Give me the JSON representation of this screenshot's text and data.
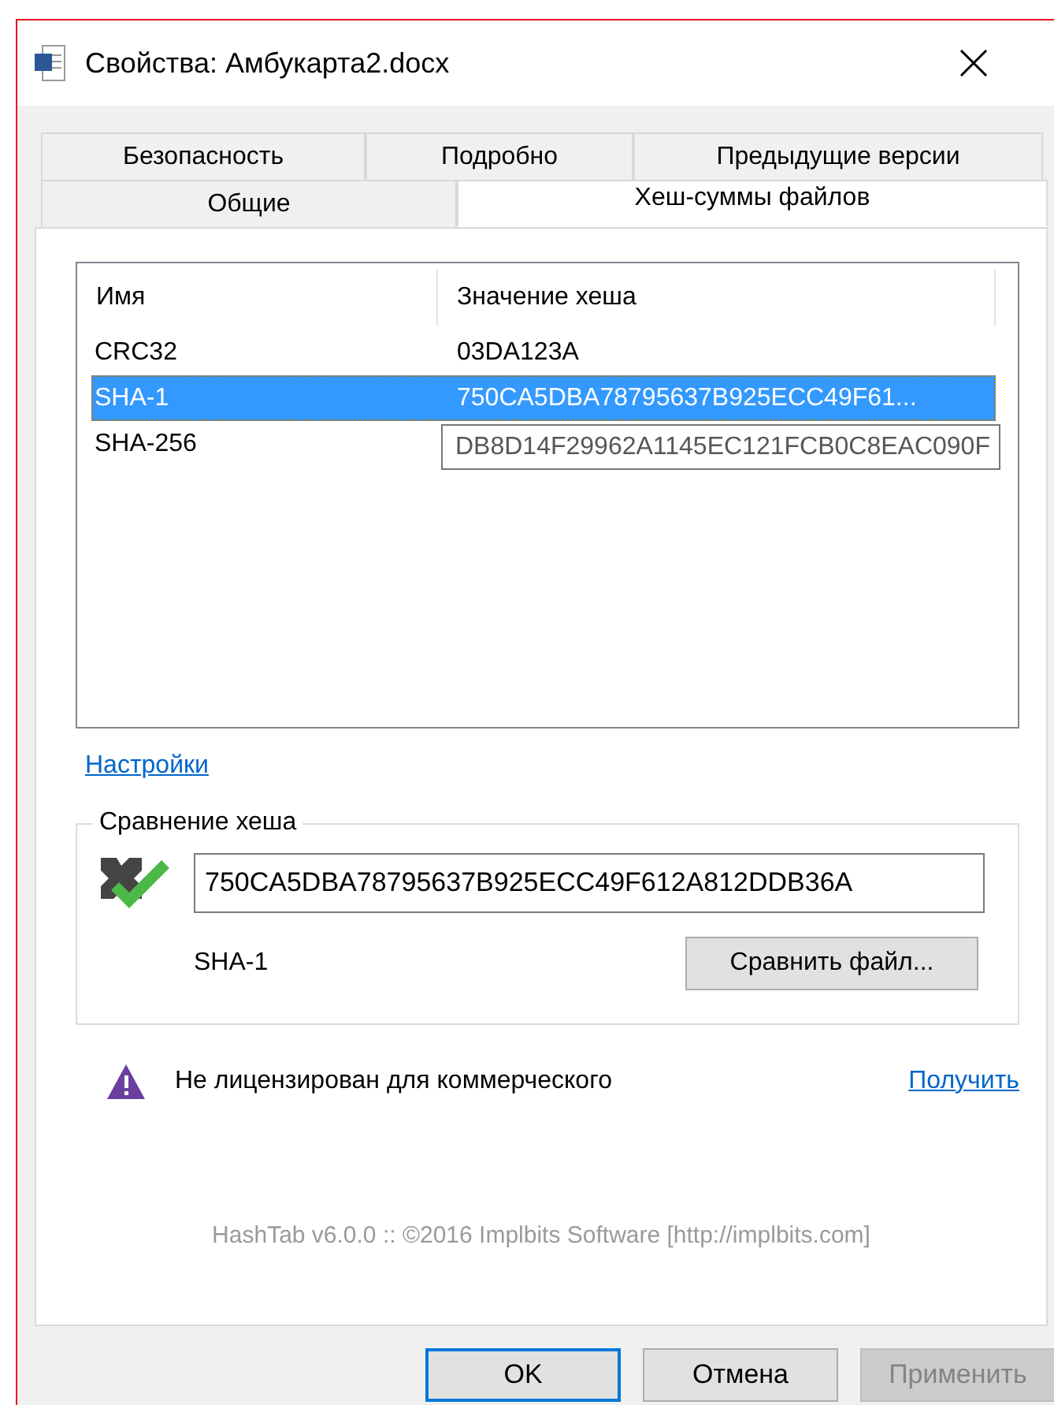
{
  "window": {
    "title": "Свойства: Амбукарта2.docx"
  },
  "tab_rows": [
    {
      "tabs": [
        {
          "label": "Безопасность",
          "selected": false
        },
        {
          "label": "Подробно",
          "selected": false
        },
        {
          "label": "Предыдущие версии",
          "selected": false
        }
      ]
    },
    {
      "tabs": [
        {
          "label": "Общие",
          "selected": false
        },
        {
          "label": "Хеш-суммы файлов",
          "selected": true
        }
      ]
    }
  ],
  "hash_list": {
    "columns": [
      "Имя",
      "Значение хеша"
    ],
    "rows": [
      {
        "name": "CRC32",
        "value": "03DA123A",
        "selected": false
      },
      {
        "name": "SHA-1",
        "value": "750CA5DBA78795637B925ECC49F61...",
        "selected": true
      },
      {
        "name": "SHA-256",
        "selected": false
      }
    ],
    "tooltip": "DB8D14F29962A1145EC121FCB0C8EAC090F"
  },
  "settings_link": "Настройки",
  "compare": {
    "legend": "Сравнение хеша",
    "value": "750CA5DBA78795637B925ECC49F612A812DDB36A",
    "algorithm": "SHA-1",
    "button": "Сравнить файл..."
  },
  "license": {
    "message": "Не лицензирован для коммерческого",
    "link": "Получить"
  },
  "footer": "HashTab v6.0.0 :: ©2016 Implbits Software [http://implbits.com]",
  "buttons": [
    {
      "label": "OK",
      "kind": "default"
    },
    {
      "label": "Отмена",
      "kind": "normal"
    },
    {
      "label": "Применить",
      "kind": "disabled"
    }
  ]
}
